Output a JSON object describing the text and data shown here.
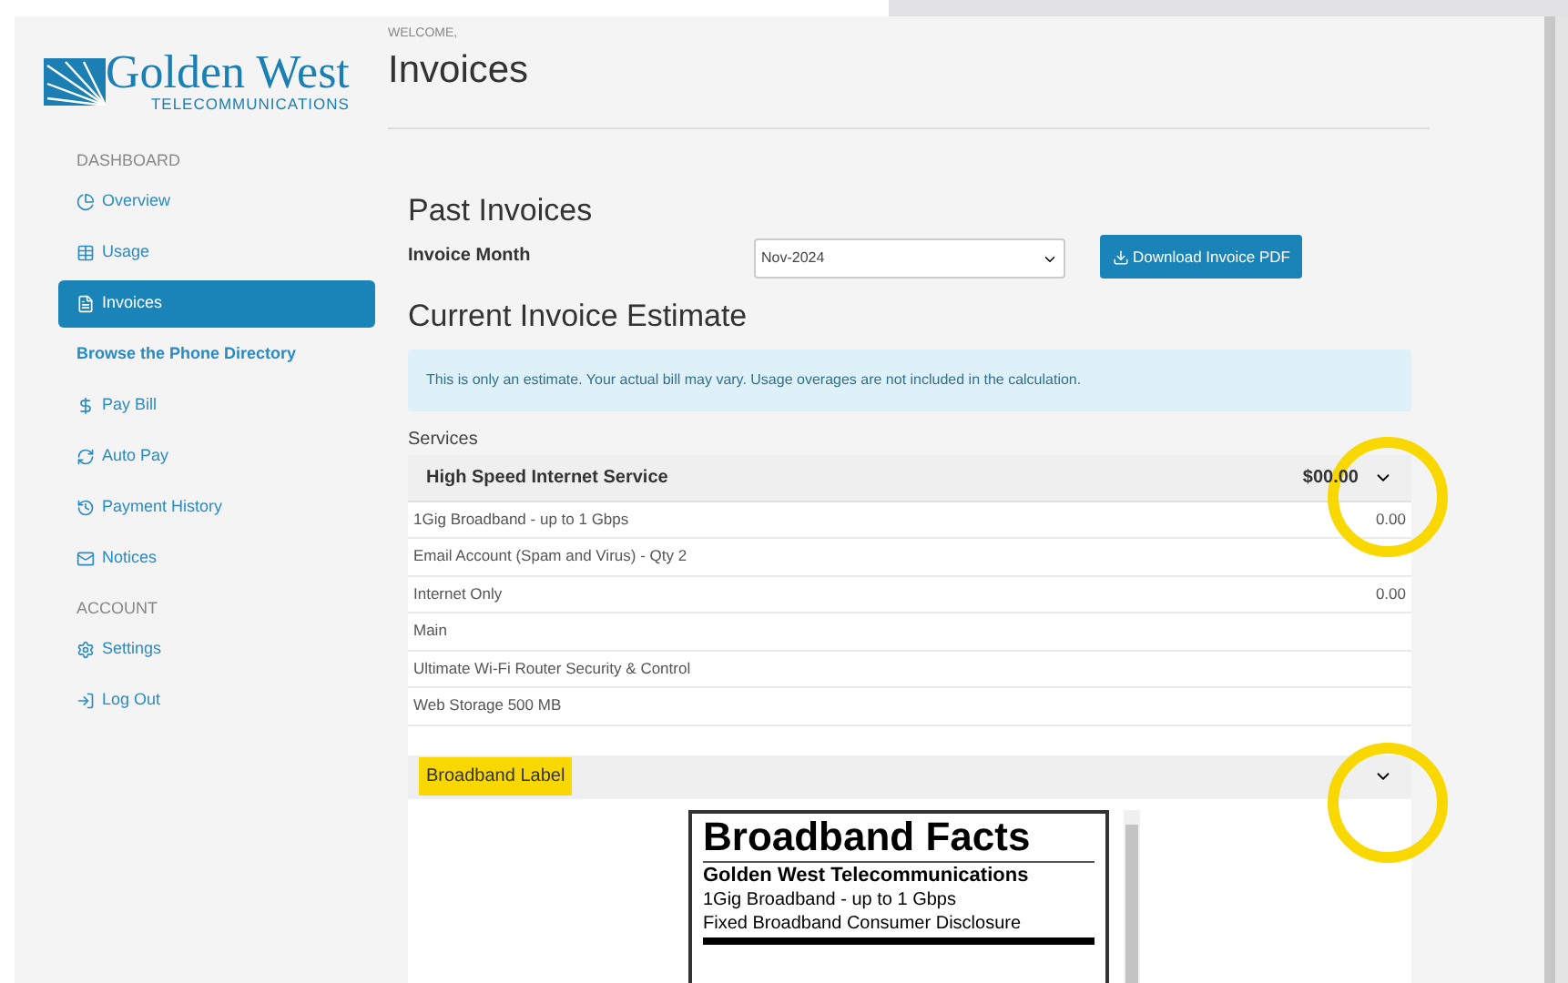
{
  "logo": {
    "name": "Golden West",
    "tagline": "TELECOMMUNICATIONS"
  },
  "sidebar": {
    "sections": [
      {
        "heading": "DASHBOARD",
        "items": [
          {
            "label": "Overview",
            "selected": false,
            "kind": "link"
          },
          {
            "label": "Usage",
            "selected": false,
            "kind": "link"
          },
          {
            "label": "Invoices",
            "selected": true,
            "kind": "link"
          },
          {
            "label": "Browse the Phone Directory",
            "selected": false,
            "kind": "bold"
          },
          {
            "label": "Pay Bill",
            "selected": false,
            "kind": "link"
          },
          {
            "label": "Auto Pay",
            "selected": false,
            "kind": "link"
          },
          {
            "label": "Payment History",
            "selected": false,
            "kind": "link"
          },
          {
            "label": "Notices",
            "selected": false,
            "kind": "link"
          }
        ]
      },
      {
        "heading": "ACCOUNT",
        "items": [
          {
            "label": "Settings",
            "selected": false,
            "kind": "link"
          },
          {
            "label": "Log Out",
            "selected": false,
            "kind": "link"
          }
        ]
      }
    ]
  },
  "header": {
    "welcome": "WELCOME,",
    "title": "Invoices"
  },
  "past_invoices": {
    "title": "Past Invoices",
    "label": "Invoice Month",
    "month": "Nov-2024",
    "button": "Download Invoice PDF"
  },
  "estimate": {
    "title": "Current Invoice Estimate",
    "notice": "This is only an estimate. Your actual bill may vary. Usage overages are not included in the calculation.",
    "services_label": "Services",
    "service": {
      "name": "High Speed Internet Service",
      "total": "$00.00",
      "expanded": true,
      "rows": [
        {
          "label": "1Gig Broadband - up to 1 Gbps",
          "amount": "0.00"
        },
        {
          "label": "Email Account (Spam and Virus) - Qty 2"
        },
        {
          "label": "Internet Only",
          "amount": "0.00"
        },
        {
          "label": "Main"
        },
        {
          "label": "Ultimate Wi-Fi Router Security & Control"
        },
        {
          "label": "Web Storage 500 MB"
        }
      ]
    },
    "label_panel": {
      "name": "Broadband Label",
      "highlighted": true,
      "expanded": true,
      "facts": {
        "title": "Broadband Facts",
        "company": "Golden West Telecommunications",
        "plan": "1Gig Broadband - up to 1 Gbps",
        "disclosure": "Fixed Broadband Consumer Disclosure"
      }
    }
  }
}
